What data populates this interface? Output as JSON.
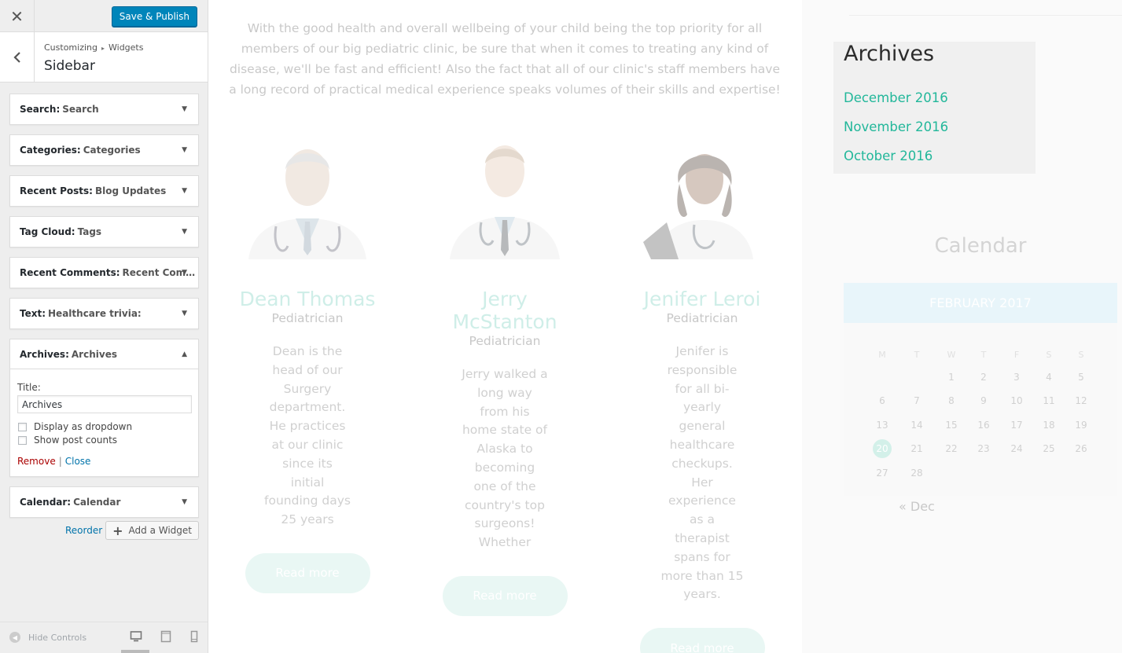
{
  "customizer": {
    "close_glyph": "✕",
    "save_label": "Save & Publish",
    "breadcrumb": {
      "part1": "Customizing",
      "sep": "▸",
      "part2": "Widgets"
    },
    "section_title": "Sidebar",
    "widgets": [
      {
        "name": "Search:",
        "title": "Search",
        "open": false
      },
      {
        "name": "Categories:",
        "title": "Categories",
        "open": false
      },
      {
        "name": "Recent Posts:",
        "title": "Blog Updates",
        "open": false
      },
      {
        "name": "Tag Cloud:",
        "title": "Tags",
        "open": false
      },
      {
        "name": "Recent Comments:",
        "title": "Recent Com…",
        "open": false
      },
      {
        "name": "Text:",
        "title": "Healthcare trivia:",
        "open": false
      },
      {
        "name": "Archives:",
        "title": "Archives",
        "open": true
      },
      {
        "name": "Calendar:",
        "title": "Calendar",
        "open": false
      }
    ],
    "archives_form": {
      "title_label": "Title:",
      "title_value": "Archives",
      "dropdown_label": "Display as dropdown",
      "post_counts_label": "Show post counts",
      "remove_label": "Remove",
      "sep": "|",
      "close_label": "Close"
    },
    "reorder_label": "Reorder",
    "add_widget_label": "Add a Widget",
    "hide_controls_label": "Hide Controls"
  },
  "preview": {
    "intro": "With the good health and overall wellbeing of your child being the top priority for all members of our big pediatric clinic, be sure that when it comes to treating any kind of disease, we'll be fast and efficient! Also the fact that all of our clinic's staff members have a long record of practical medical experience speaks volumes of their skills and expertise!",
    "doctors": [
      {
        "name": "Dean Thomas",
        "role": "Pediatrician",
        "bio": "Dean is the head of our Surgery department. He practices at our clinic since its initial founding days 25 years",
        "button": "Read more"
      },
      {
        "name": "Jerry McStanton",
        "role": "Pediatrician",
        "bio": "Jerry walked a long way from his home state of Alaska to becoming one of the country's top surgeons! Whether",
        "button": "Read more"
      },
      {
        "name": "Jenifer Leroi",
        "role": "Pediatrician",
        "bio": "Jenifer is responsible for all bi-yearly general healthcare checkups. Her experience as a therapist spans for more than 15 years.",
        "button": "Read more"
      }
    ],
    "archives": {
      "title": "Archives",
      "links": [
        "December 2016",
        "November 2016",
        "October 2016"
      ]
    },
    "calendar": {
      "title": "Calendar",
      "month": "FEBRUARY 2017",
      "weekdays": [
        "M",
        "T",
        "W",
        "T",
        "F",
        "S",
        "S"
      ],
      "weeks": [
        [
          "",
          "",
          "1",
          "2",
          "3",
          "4",
          "5"
        ],
        [
          "6",
          "7",
          "8",
          "9",
          "10",
          "11",
          "12"
        ],
        [
          "13",
          "14",
          "15",
          "16",
          "17",
          "18",
          "19"
        ],
        [
          "20",
          "21",
          "22",
          "23",
          "24",
          "25",
          "26"
        ],
        [
          "27",
          "28",
          "",
          "",
          "",
          "",
          ""
        ]
      ],
      "today": "20",
      "prev_link": "« Dec"
    }
  }
}
